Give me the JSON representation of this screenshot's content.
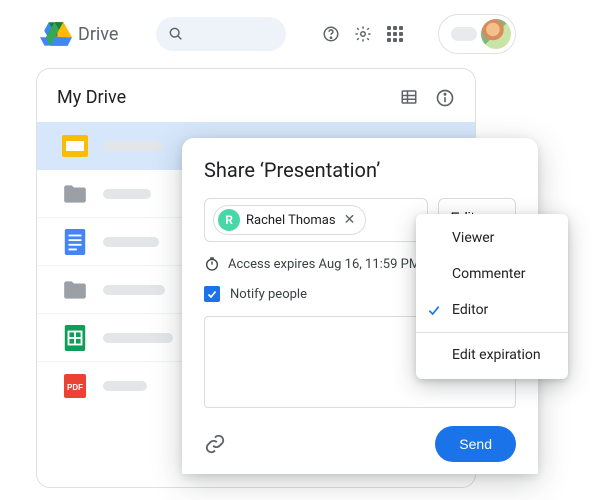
{
  "header": {
    "product_name": "Drive"
  },
  "drive": {
    "title": "My Drive",
    "rows": [
      {
        "type": "slides"
      },
      {
        "type": "folder"
      },
      {
        "type": "docs"
      },
      {
        "type": "folder"
      },
      {
        "type": "sheets"
      },
      {
        "type": "pdf"
      }
    ]
  },
  "share": {
    "title": "Share ‘Presentation’",
    "person": {
      "initial": "R",
      "name": "Rachel Thomas"
    },
    "role_btn_label": "Editor",
    "expires_text": "Access expires Aug 16, 11:59 PM",
    "notify_label": "Notify people",
    "send_label": "Send"
  },
  "role_menu": {
    "viewer": "Viewer",
    "commenter": "Commenter",
    "editor": "Editor",
    "edit_expiration": "Edit expiration"
  }
}
